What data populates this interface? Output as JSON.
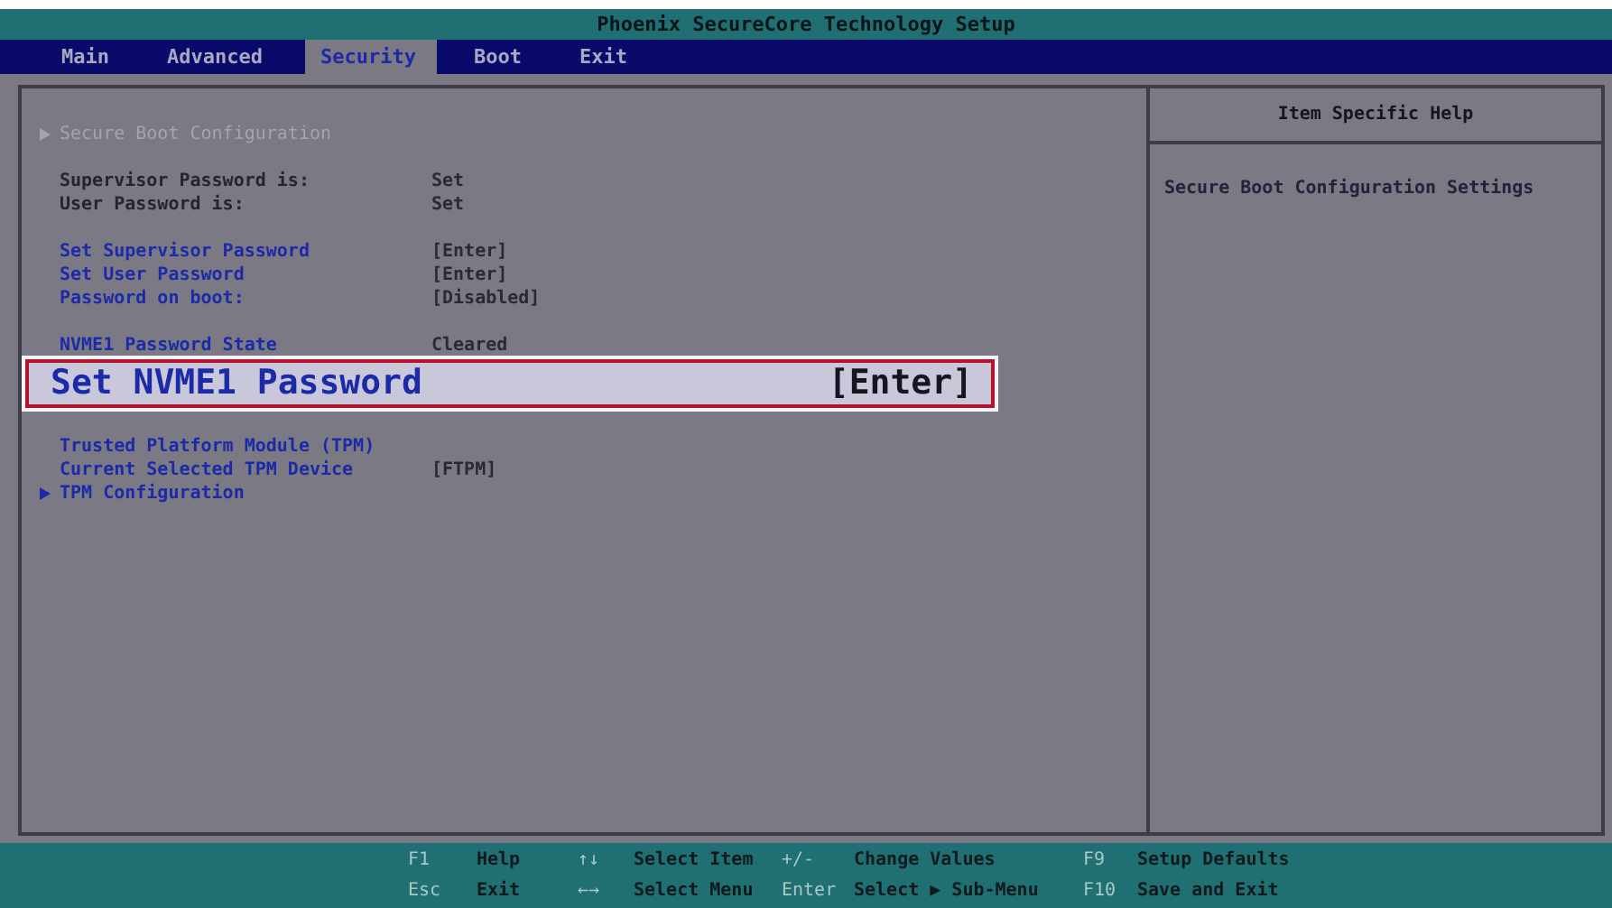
{
  "window": {
    "title": "Phoenix SecureCore Technology Setup"
  },
  "tabs": [
    {
      "label": "Main",
      "selected": false
    },
    {
      "label": "Advanced",
      "selected": false
    },
    {
      "label": "Security",
      "selected": true
    },
    {
      "label": "Boot",
      "selected": false
    },
    {
      "label": "Exit",
      "selected": false
    }
  ],
  "items": [
    {
      "kind": "submenu",
      "label": "Secure Boot Configuration",
      "disabled": true,
      "selected": false
    },
    {
      "kind": "gap"
    },
    {
      "kind": "info",
      "label": "Supervisor Password is:",
      "value": "Set",
      "disabled": false,
      "selected": false
    },
    {
      "kind": "info",
      "label": "User Password is:",
      "value": "Set",
      "disabled": false,
      "selected": false
    },
    {
      "kind": "gap"
    },
    {
      "kind": "setting",
      "label": "Set Supervisor Password",
      "value": "[Enter]",
      "disabled": false,
      "selected": false
    },
    {
      "kind": "setting",
      "label": "Set User Password",
      "value": "[Enter]",
      "disabled": false,
      "selected": false
    },
    {
      "kind": "setting",
      "label": "Password on boot:",
      "value": "[Disabled]",
      "disabled": false,
      "selected": false
    },
    {
      "kind": "gap"
    },
    {
      "kind": "setting",
      "label": "NVME1 Password State",
      "value": "Cleared",
      "disabled": false,
      "selected": false
    },
    {
      "kind": "setting",
      "label": "Set NVME1 Password",
      "value": "[Enter]",
      "disabled": false,
      "selected": true
    },
    {
      "kind": "gap"
    },
    {
      "kind": "setting",
      "label": "Trusted Platform Module  (TPM)",
      "disabled": false,
      "selected": false
    },
    {
      "kind": "setting",
      "label": "Current Selected TPM Device",
      "value": "[FTPM]",
      "disabled": false,
      "selected": false
    },
    {
      "kind": "submenu",
      "label": "TPM Configuration",
      "disabled": false,
      "selected": false
    }
  ],
  "help": {
    "title": "Item Specific Help",
    "text": "Secure Boot Configuration Settings"
  },
  "status_bar": [
    {
      "key": "F1",
      "action": "Help"
    },
    {
      "key": "↑↓",
      "action": "Select Item"
    },
    {
      "key": "+/-",
      "action": "Change Values"
    },
    {
      "key": "F9",
      "action": "Setup Defaults"
    },
    {
      "key": "Esc",
      "action": "Exit"
    },
    {
      "key": "←→",
      "action": "Select Menu"
    },
    {
      "key": "Enter",
      "action": "Select ▶ Sub-Menu"
    },
    {
      "key": "F10",
      "action": "Save and Exit"
    }
  ]
}
